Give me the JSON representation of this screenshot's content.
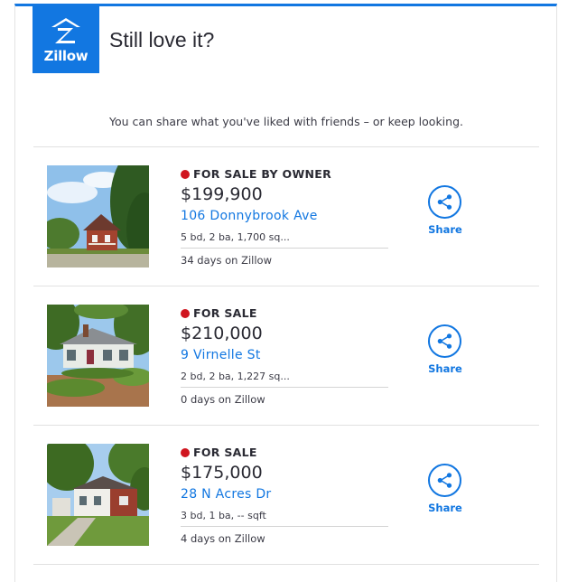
{
  "email": {
    "logo_text": "Zillow",
    "headline": "Still love it?",
    "intro": "You can share what you've liked with friends – or keep looking."
  },
  "colors": {
    "brand_blue": "#1277e1",
    "status_red": "#d0151f",
    "text_dark": "#2a2a33"
  },
  "listings": [
    {
      "status": "FOR SALE BY OWNER",
      "price": "$199,900",
      "address": "106 Donnybrook Ave",
      "facts": "5 bd, 2 ba, 1,700 sq...",
      "days_on_zillow": "34 days on Zillow",
      "share_label": "Share",
      "share_icon": "share-icon",
      "photo": "house-photo-red-brick-cottage"
    },
    {
      "status": "FOR SALE",
      "price": "$210,000",
      "address": "9 Virnelle St",
      "facts": "2 bd, 2 ba, 1,227 sq...",
      "days_on_zillow": "0 days on Zillow",
      "share_label": "Share",
      "share_icon": "share-icon",
      "photo": "house-photo-white-bungalow"
    },
    {
      "status": "FOR SALE",
      "price": "$175,000",
      "address": "28 N Acres Dr",
      "facts": "3 bd, 1 ba, -- sqft",
      "days_on_zillow": "4 days on Zillow",
      "share_label": "Share",
      "share_icon": "share-icon",
      "photo": "house-photo-brick-ranch"
    }
  ]
}
